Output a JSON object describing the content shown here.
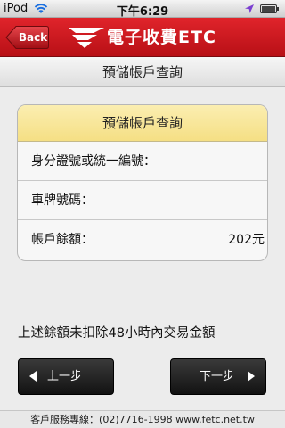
{
  "status_bar": {
    "carrier": "iPod",
    "time": "下午6:29",
    "icons": [
      "wifi-icon",
      "location-arrow-icon",
      "battery-icon"
    ]
  },
  "nav_bar": {
    "back_label": "Back",
    "title": "電子收費ETC",
    "logo_icon": "etc-logo-icon",
    "color": "#d01a20"
  },
  "page": {
    "title": "預儲帳戶查詢"
  },
  "card": {
    "header": "預儲帳戶查詢",
    "header_color": "#f8e79a",
    "rows": [
      {
        "label": "身分證號或統一編號：",
        "value": ""
      },
      {
        "label": "車牌號碼：",
        "value": ""
      },
      {
        "label": "帳戶餘額：",
        "value": "202元"
      }
    ]
  },
  "note": "上述餘額未扣除48小時內交易金額",
  "buttons": {
    "prev_label": "上一步",
    "next_label": "下一步"
  },
  "footer": {
    "text": "客戶服務專線：(02)7716-1998 www.fetc.net.tw"
  }
}
